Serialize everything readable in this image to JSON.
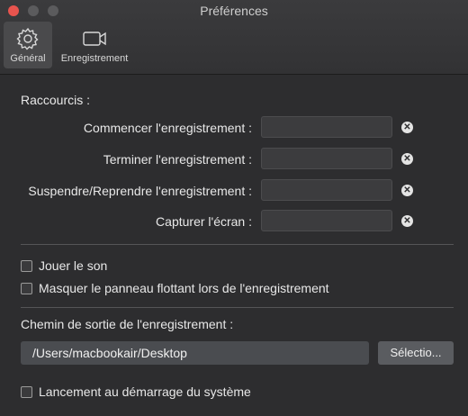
{
  "window": {
    "title": "Préférences"
  },
  "toolbar": {
    "tabs": [
      {
        "label": "Général",
        "icon": "gear-icon",
        "selected": true
      },
      {
        "label": "Enregistrement",
        "icon": "video-camera-icon",
        "selected": false
      }
    ]
  },
  "shortcuts": {
    "heading": "Raccourcis :",
    "items": [
      {
        "label": "Commencer l'enregistrement :",
        "value": ""
      },
      {
        "label": "Terminer l'enregistrement :",
        "value": ""
      },
      {
        "label": "Suspendre/Reprendre l'enregistrement :",
        "value": ""
      },
      {
        "label": "Capturer l'écran :",
        "value": ""
      }
    ]
  },
  "options": {
    "play_sound": {
      "label": "Jouer le son",
      "checked": false
    },
    "hide_panel": {
      "label": "Masquer le panneau flottant lors de l'enregistrement",
      "checked": false
    }
  },
  "output": {
    "heading": "Chemin de sortie de l'enregistrement :",
    "path": "/Users/macbookair/Desktop",
    "select_label": "Sélectio..."
  },
  "startup": {
    "label": "Lancement au démarrage du système",
    "checked": false
  },
  "colors": {
    "close_button": "#e8544e",
    "window_bg": "#2d2d2f",
    "field_bg": "#3c3c3e"
  }
}
